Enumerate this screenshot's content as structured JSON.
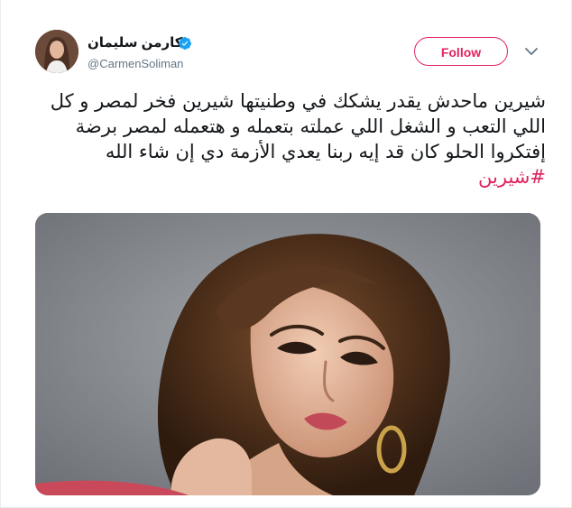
{
  "author": {
    "display_name": "كارمن سليمان",
    "screen_name": "@CarmenSoliman",
    "verified": true
  },
  "header": {
    "follow_label": "Follow",
    "follow_color": "#e0245e"
  },
  "tweet": {
    "text_before_hashtag": "شيرين ماحدش يقدر يشكك في وطنيتها شيرين فخر لمصر و كل اللي التعب و الشغل اللي عملته بتعمله و هتعمله لمصر برضة  إفتكروا الحلو كان قد إيه ربنا يعدي الأزمة دي إن شاء الله ",
    "hashtag": "#شيرين",
    "hashtag_color": "#e0245e"
  },
  "media": {
    "type": "photo"
  },
  "icons": {
    "verified": "verified-badge-icon",
    "caret": "chevron-down-icon"
  },
  "colors": {
    "verified_blue": "#1da1f2",
    "secondary_text": "#657786"
  }
}
